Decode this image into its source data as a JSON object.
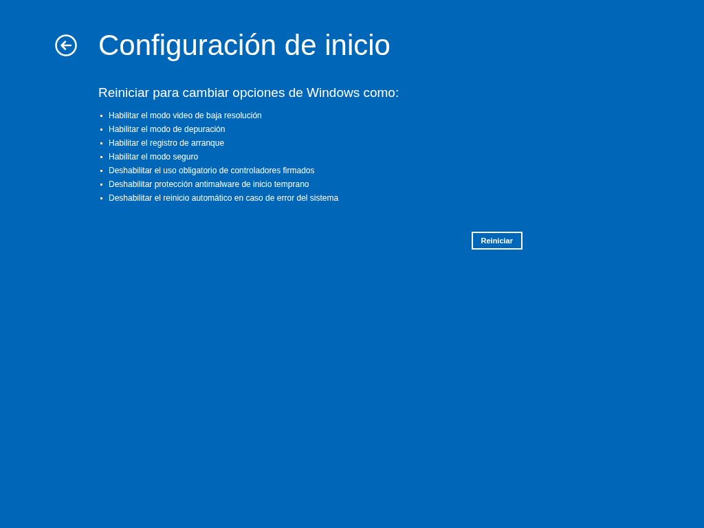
{
  "title": "Configuración de inicio",
  "subtitle": "Reiniciar para cambiar opciones de Windows como:",
  "options": [
    "Habilitar el modo video de baja resolución",
    "Habilitar el modo de depuración",
    "Habilitar el registro de arranque",
    "Habilitar el modo seguro",
    "Deshabilitar el uso obligatorio de controladores firmados",
    "Deshabilitar protección antimalware de inicio temprano",
    "Deshabilitar el reinicio automático en caso de error del sistema"
  ],
  "button": "Reiniciar"
}
